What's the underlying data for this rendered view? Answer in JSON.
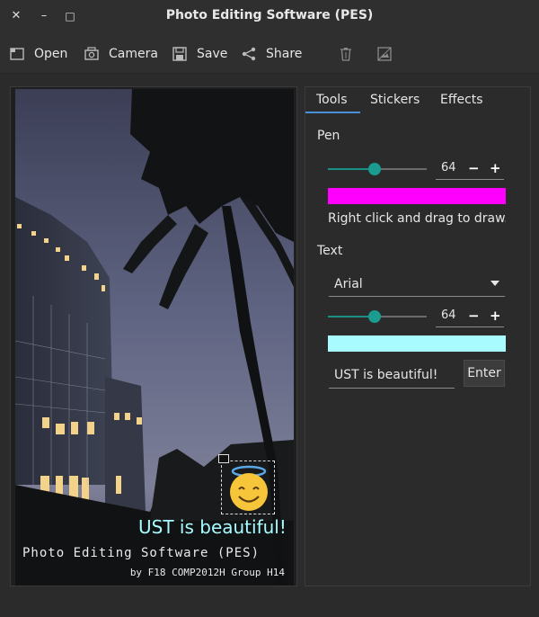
{
  "window": {
    "title": "Photo Editing Software (PES)",
    "close_glyph": "✕",
    "minimize_glyph": "–",
    "maximize_glyph": "□"
  },
  "toolbar": {
    "open_label": "Open",
    "camera_label": "Camera",
    "save_label": "Save",
    "share_label": "Share",
    "icons": [
      "open-icon",
      "camera-icon",
      "save-icon",
      "share-icon",
      "trash-icon",
      "image-clear-icon"
    ]
  },
  "canvas": {
    "caption": "UST is beautiful!",
    "caption_color": "#a8fbff",
    "watermark_title": "Photo Editing Software (PES)",
    "watermark_credit": "by F18 COMP2012H Group H14",
    "sticker_icon": "smiling-face-with-halo-icon"
  },
  "panel": {
    "tabs": [
      "Tools",
      "Stickers",
      "Effects"
    ],
    "active_tab": "Tools",
    "pen": {
      "label": "Pen",
      "size": "64",
      "size_fraction": 0.47,
      "color": "#ff00ff",
      "hint": "Right click and drag to draw. Shift"
    },
    "text": {
      "label": "Text",
      "font": "Arial",
      "size": "64",
      "size_fraction": 0.47,
      "color": "#a8fbff",
      "input_value": "UST is beautiful!",
      "enter_label": "Enter"
    },
    "minus_glyph": "−",
    "plus_glyph": "+"
  }
}
